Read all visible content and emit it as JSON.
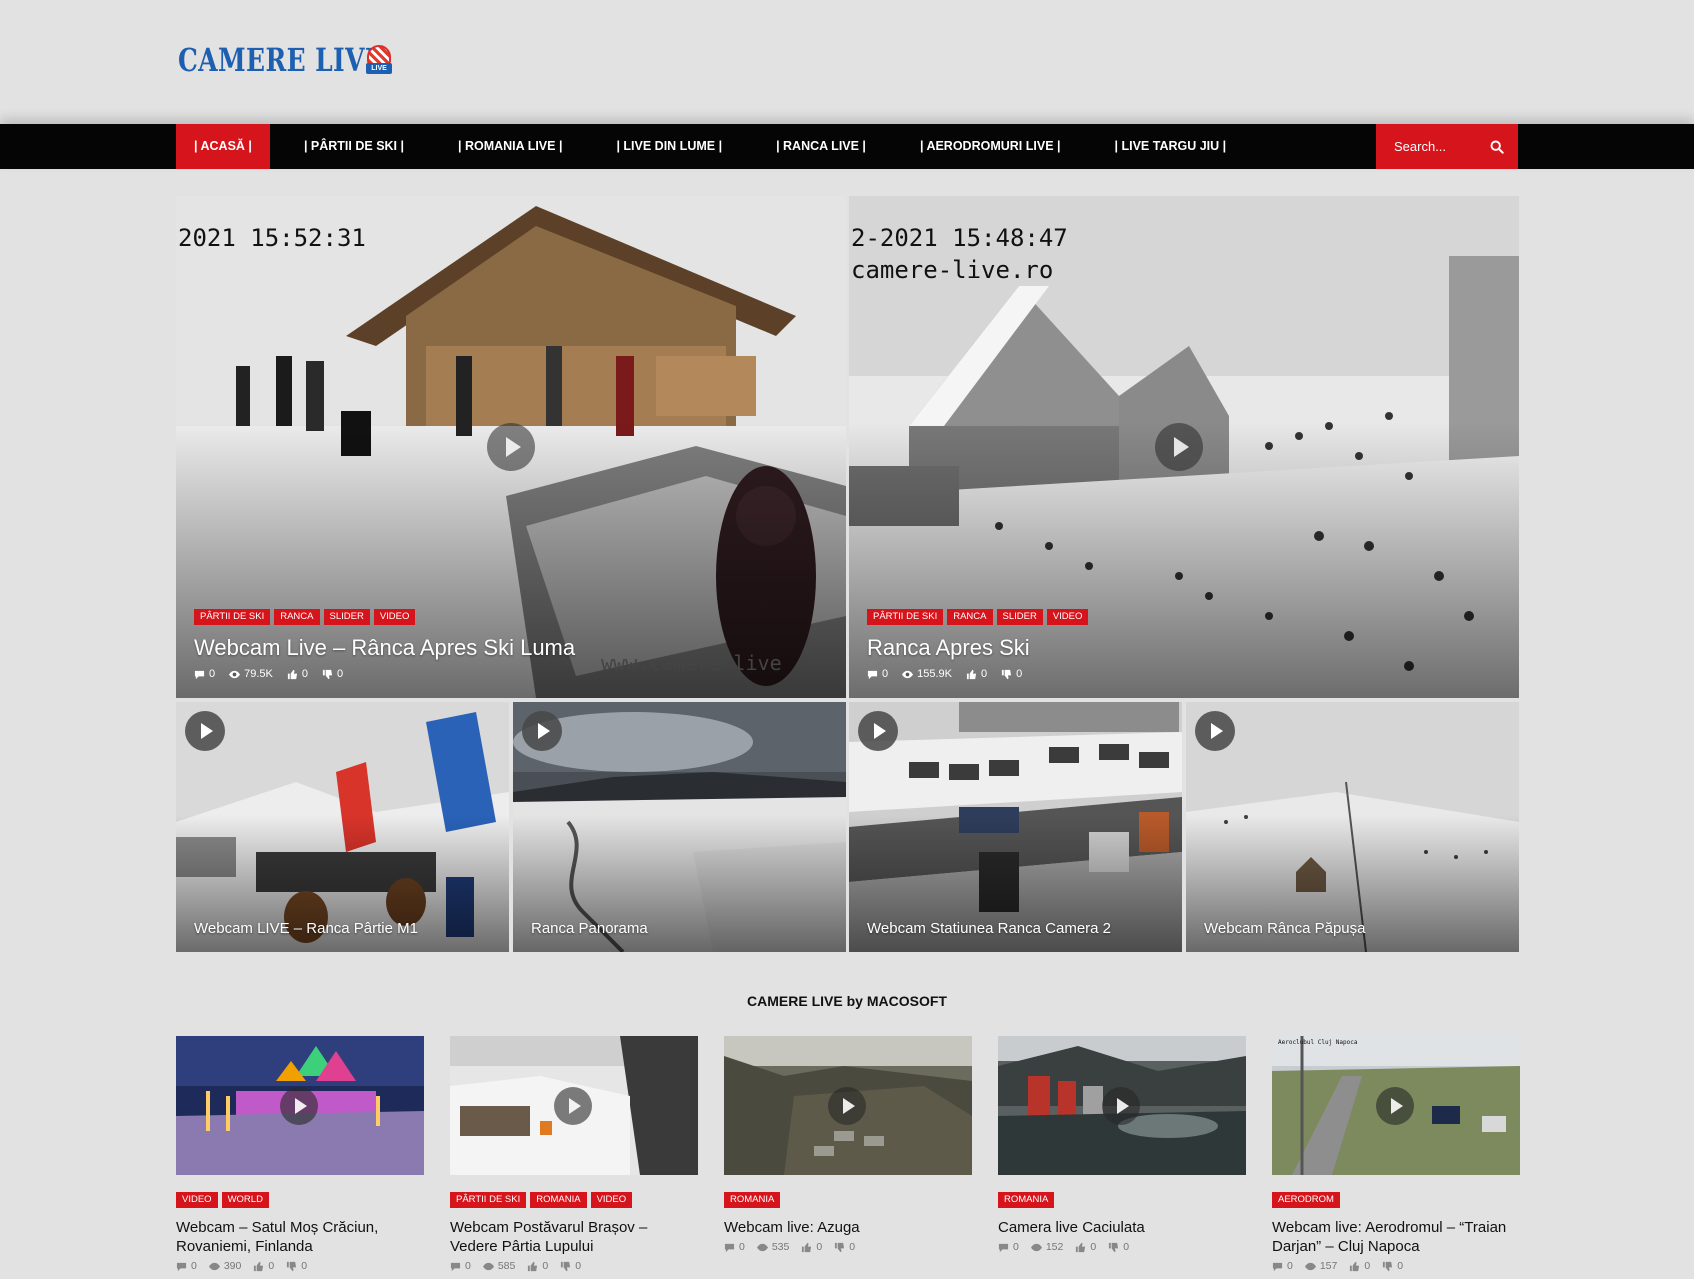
{
  "logo": {
    "text": "CAMERE LIVE",
    "badge": "LIVE"
  },
  "nav": {
    "items": [
      "| ACASĂ |",
      "| PÂRTII DE SKI |",
      "| ROMANIA LIVE |",
      "| LIVE DIN LUME |",
      "| RANCA LIVE |",
      "| AERODROMURI LIVE |",
      "| LIVE TARGU JIU |"
    ],
    "search_placeholder": "Search..."
  },
  "colors": {
    "accent": "#d5141b",
    "nav_bg": "#050505",
    "page_bg": "#e2e2e2",
    "logo_blue": "#1d5fb0"
  },
  "featured": [
    {
      "categories": [
        "PÂRTII DE SKI",
        "RANCA",
        "SLIDER",
        "VIDEO"
      ],
      "title": "Webcam Live – Rânca Apres Ski Luma",
      "overlay_timestamp": "2021 15:52:31",
      "overlay_watermark": "www.camere-live",
      "stats": {
        "comments": "0",
        "views": "79.5K",
        "likes": "0",
        "dislikes": "0"
      }
    },
    {
      "categories": [
        "PÂRTII DE SKI",
        "RANCA",
        "SLIDER",
        "VIDEO"
      ],
      "title": "Ranca Apres Ski",
      "overlay_timestamp": "2-2021 15:48:47",
      "overlay_watermark": "camere-live.ro",
      "stats": {
        "comments": "0",
        "views": "155.9K",
        "likes": "0",
        "dislikes": "0"
      }
    }
  ],
  "small_tiles": [
    {
      "title": "Webcam LIVE – Ranca Pârtie M1"
    },
    {
      "title": "Ranca Panorama"
    },
    {
      "title": "Webcam Statiunea Ranca Camera 2"
    },
    {
      "title": "Webcam Rânca Păpușa"
    }
  ],
  "section": {
    "title": "CAMERE LIVE by MACOSOFT"
  },
  "cards": [
    {
      "categories": [
        "VIDEO",
        "WORLD"
      ],
      "title": "Webcam – Satul Moș Crăciun, Rovaniemi, Finlanda",
      "stats": {
        "comments": "0",
        "views": "390",
        "likes": "0",
        "dislikes": "0"
      }
    },
    {
      "categories": [
        "PÂRTII DE SKI",
        "ROMANIA",
        "VIDEO"
      ],
      "title": "Webcam Postăvarul Brașov – Vedere Pârtia Lupului",
      "stats": {
        "comments": "0",
        "views": "585",
        "likes": "0",
        "dislikes": "0"
      }
    },
    {
      "categories": [
        "ROMANIA"
      ],
      "title": "Webcam live: Azuga",
      "stats": {
        "comments": "0",
        "views": "535",
        "likes": "0",
        "dislikes": "0"
      }
    },
    {
      "categories": [
        "ROMANIA"
      ],
      "title": "Camera live Caciulata",
      "stats": {
        "comments": "0",
        "views": "152",
        "likes": "0",
        "dislikes": "0"
      }
    },
    {
      "categories": [
        "AERODROM"
      ],
      "title": "Webcam live: Aerodromul – “Traian Darjan” – Cluj Napoca",
      "overlay_text": "Aeroclubul Cluj Napoca",
      "stats": {
        "comments": "0",
        "views": "157",
        "likes": "0",
        "dislikes": "0"
      }
    }
  ]
}
